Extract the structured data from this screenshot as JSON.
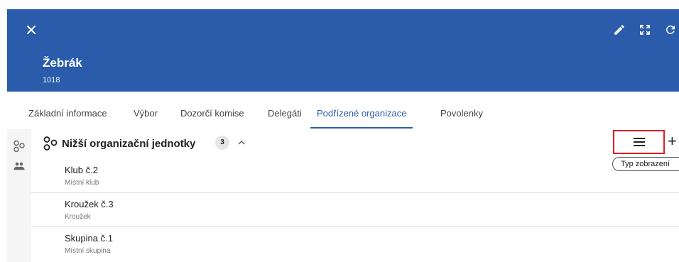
{
  "colors": {
    "header_bg": "#2a5cab",
    "accent": "#2a5cab",
    "highlight_border": "#e01e1e"
  },
  "header": {
    "title": "Žebrák",
    "subtitle": "1018",
    "icons": {
      "close": "close-icon",
      "edit": "pencil-icon",
      "fullscreen": "fullscreen-icon",
      "refresh": "refresh-icon"
    }
  },
  "tabs": [
    {
      "label": "Základní informace"
    },
    {
      "label": "Výbor"
    },
    {
      "label": "Dozorčí komise"
    },
    {
      "label": "Delegáti"
    },
    {
      "label": "Podřízené organizace",
      "active": true
    },
    {
      "label": "Povolenky"
    }
  ],
  "rail": {
    "icons": [
      "org-structure-icon",
      "people-icon"
    ]
  },
  "section": {
    "title": "Nižší organizační jednotky",
    "count": "3",
    "icons": {
      "section": "org-structure-icon",
      "collapse": "chevron-up-icon"
    }
  },
  "toolbar": {
    "view_type_icon": "menu-lines-icon",
    "add_label": "+",
    "tooltip": "Typ zobrazení"
  },
  "items": [
    {
      "title": "Klub č.2",
      "subtitle": "Místní klub"
    },
    {
      "title": "Kroužek č.3",
      "subtitle": "Kroužek"
    },
    {
      "title": "Skupina č.1",
      "subtitle": "Místní skupina"
    }
  ]
}
